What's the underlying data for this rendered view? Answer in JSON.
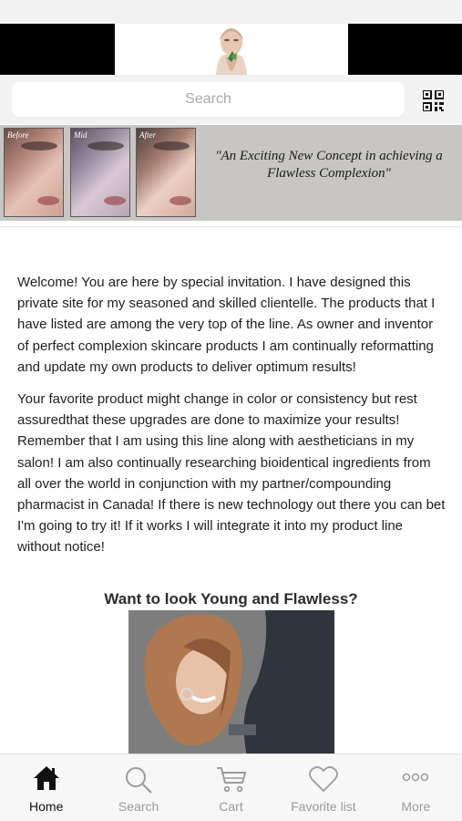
{
  "header": {
    "logo_name": "woman-face-logo"
  },
  "search": {
    "placeholder": "Search",
    "qr_icon": "qr-code-icon"
  },
  "banner": {
    "labels": [
      "Before",
      "Mid",
      "After"
    ],
    "quote": "\"An Exciting New Concept in achieving a Flawless Complexion\""
  },
  "content": {
    "paragraph1": "Welcome! You are here by special invitation. I have designed this private site for my seasoned and skilled clientelle. The products that I have listed are among the very top of the line. As owner and inventor of perfect complexion skincare products I am continually reformatting and update my own products to deliver optimum results!",
    "paragraph2": "Your favorite product might change in color or consistency but rest assuredthat these upgrades are done to maximize your results! Remember that I am using this line along with aestheticians in my salon! I am also continually researching bioidentical ingredients from all over the world in conjunction with my partner/compounding pharmacist in Canada! If there is new technology out there you can bet I'm going to try it! If it works I will integrate it into my product line without notice!",
    "cta": "Want to look Young and Flawless?"
  },
  "tabbar": {
    "active": "Home",
    "tabs": [
      {
        "label": "Home",
        "icon": "home-icon"
      },
      {
        "label": "Search",
        "icon": "search-icon"
      },
      {
        "label": "Cart",
        "icon": "cart-icon"
      },
      {
        "label": "Favorite list",
        "icon": "heart-icon"
      },
      {
        "label": "More",
        "icon": "more-icon"
      }
    ]
  },
  "colors": {
    "accent": "#111111",
    "inactive": "#9b9b9b",
    "header_bg": "#f2f2f2",
    "banner_bg": "#c8c6c3"
  }
}
